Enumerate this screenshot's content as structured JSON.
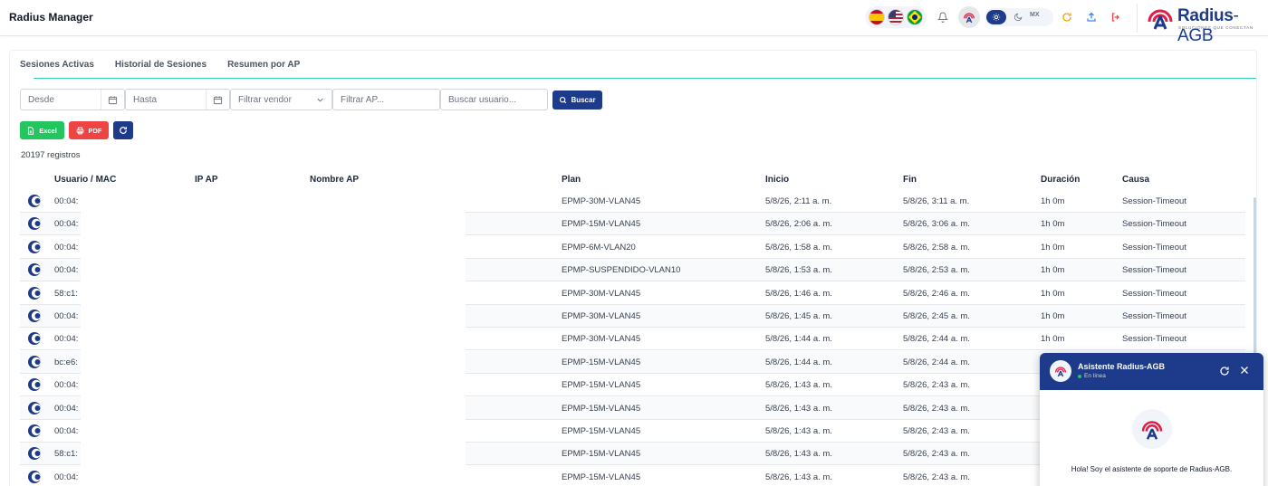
{
  "app": {
    "title": "Radius Manager",
    "logo_word": "Radius",
    "logo_accent": "-AGB",
    "logo_tagline": "SOLUCIONES QUE CONECTAN",
    "theme_lang": "MX"
  },
  "tabs": [
    {
      "label": "Sesiones Activas"
    },
    {
      "label": "Historial de Sesiones"
    },
    {
      "label": "Resumen por AP"
    }
  ],
  "filters": {
    "desde": "Desde",
    "hasta": "Hasta",
    "vendor": "Filtrar vendor",
    "ap": "Filtrar AP...",
    "usuario": "Buscar usuario...",
    "buscar_label": "Buscar"
  },
  "actions": {
    "excel_label": "Excel",
    "pdf_label": "PDF"
  },
  "record_count": "20197 registros",
  "table": {
    "columns": [
      "Usuario / MAC",
      "IP AP",
      "Nombre AP",
      "Plan",
      "Inicio",
      "Fin",
      "Duración",
      "Causa"
    ],
    "rows": [
      {
        "mac": "00:04:",
        "plan": "EPMP-30M-VLAN45",
        "inicio": "5/8/26, 2:11 a. m.",
        "fin": "5/8/26, 3:11 a. m.",
        "duracion": "1h 0m",
        "causa": "Session-Timeout"
      },
      {
        "mac": "00:04:",
        "plan": "EPMP-15M-VLAN45",
        "inicio": "5/8/26, 2:06 a. m.",
        "fin": "5/8/26, 3:06 a. m.",
        "duracion": "1h 0m",
        "causa": "Session-Timeout"
      },
      {
        "mac": "00:04:",
        "plan": "EPMP-6M-VLAN20",
        "inicio": "5/8/26, 1:58 a. m.",
        "fin": "5/8/26, 2:58 a. m.",
        "duracion": "1h 0m",
        "causa": "Session-Timeout"
      },
      {
        "mac": "00:04:",
        "plan": "EPMP-SUSPENDIDO-VLAN10",
        "inicio": "5/8/26, 1:53 a. m.",
        "fin": "5/8/26, 2:53 a. m.",
        "duracion": "1h 0m",
        "causa": "Session-Timeout"
      },
      {
        "mac": "58:c1:",
        "plan": "EPMP-30M-VLAN45",
        "inicio": "5/8/26, 1:46 a. m.",
        "fin": "5/8/26, 2:46 a. m.",
        "duracion": "1h 0m",
        "causa": "Session-Timeout"
      },
      {
        "mac": "00:04:",
        "plan": "EPMP-30M-VLAN45",
        "inicio": "5/8/26, 1:45 a. m.",
        "fin": "5/8/26, 2:45 a. m.",
        "duracion": "1h 0m",
        "causa": "Session-Timeout"
      },
      {
        "mac": "00:04:",
        "plan": "EPMP-30M-VLAN45",
        "inicio": "5/8/26, 1:44 a. m.",
        "fin": "5/8/26, 2:44 a. m.",
        "duracion": "1h 0m",
        "causa": "Session-Timeout"
      },
      {
        "mac": "bc:e6:",
        "plan": "EPMP-15M-VLAN45",
        "inicio": "5/8/26, 1:44 a. m.",
        "fin": "5/8/26, 2:44 a. m.",
        "duracion": "",
        "causa": ""
      },
      {
        "mac": "00:04:",
        "plan": "EPMP-15M-VLAN45",
        "inicio": "5/8/26, 1:43 a. m.",
        "fin": "5/8/26, 2:43 a. m.",
        "duracion": "",
        "causa": ""
      },
      {
        "mac": "00:04:",
        "plan": "EPMP-15M-VLAN45",
        "inicio": "5/8/26, 1:43 a. m.",
        "fin": "5/8/26, 2:43 a. m.",
        "duracion": "",
        "causa": ""
      },
      {
        "mac": "00:04:",
        "plan": "EPMP-15M-VLAN45",
        "inicio": "5/8/26, 1:43 a. m.",
        "fin": "5/8/26, 2:43 a. m.",
        "duracion": "",
        "causa": ""
      },
      {
        "mac": "58:c1:",
        "plan": "EPMP-15M-VLAN45",
        "inicio": "5/8/26, 1:43 a. m.",
        "fin": "5/8/26, 2:43 a. m.",
        "duracion": "",
        "causa": ""
      },
      {
        "mac": "00:04:",
        "plan": "EPMP-15M-VLAN45",
        "inicio": "5/8/26, 1:43 a. m.",
        "fin": "5/8/26, 2:43 a. m.",
        "duracion": "",
        "causa": ""
      }
    ]
  },
  "chat": {
    "title": "Asistente Radius-AGB",
    "status": "En línea",
    "greeting": "Hola! Soy el asistente de soporte de Radius-AGB."
  },
  "colors": {
    "primary": "#1e3a8a",
    "excel": "#22c55e",
    "pdf": "#ef4444",
    "tab_underline": "#34d399",
    "logo_accent": "#e11d48"
  },
  "icons": [
    "bell-icon",
    "avatar-icon",
    "sun-icon",
    "moon-icon",
    "refresh-icon",
    "upload-icon",
    "logout-icon",
    "calendar-icon",
    "chevron-down-icon",
    "search-icon",
    "excel-file-icon",
    "printer-icon",
    "user-session-icon",
    "close-icon"
  ]
}
